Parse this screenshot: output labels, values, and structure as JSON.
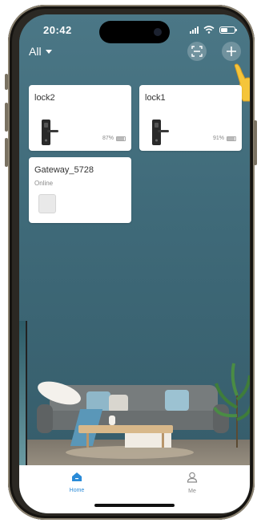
{
  "status_bar": {
    "time": "20:42"
  },
  "top_bar": {
    "filter_label": "All",
    "scan_icon": "scan-icon",
    "add_icon": "plus-icon"
  },
  "devices": [
    {
      "name": "lock2",
      "battery": "87%",
      "battery_level": 0.87,
      "icon": "door-lock-icon"
    },
    {
      "name": "lock1",
      "battery": "91%",
      "battery_level": 0.91,
      "icon": "door-lock-icon"
    },
    {
      "name": "Gateway_5728",
      "status": "Online",
      "icon": "gateway-icon"
    }
  ],
  "tab_bar": {
    "home_label": "Home",
    "me_label": "Me",
    "active": "Home"
  },
  "colors": {
    "accent": "#2a8bd8",
    "inactive": "#8a8a8a",
    "wallpaper": "#3f6a79"
  }
}
